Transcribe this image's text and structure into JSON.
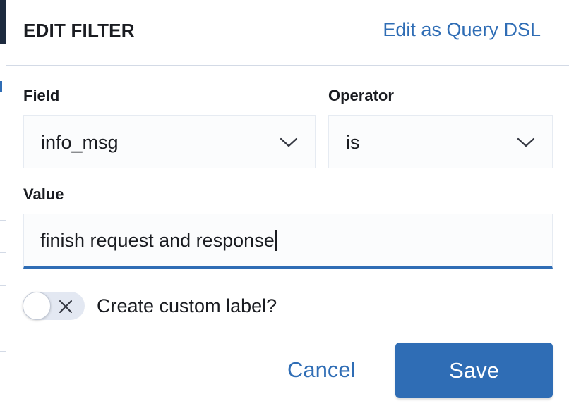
{
  "header": {
    "title": "EDIT FILTER",
    "query_link": "Edit as Query DSL"
  },
  "field": {
    "label": "Field",
    "selected": "info_msg",
    "icon": "chevron-down-icon"
  },
  "operator": {
    "label": "Operator",
    "selected": "is",
    "icon": "chevron-down-icon"
  },
  "value": {
    "label": "Value",
    "current": "finish request and response"
  },
  "custom_label": {
    "toggle_on": false,
    "toggle_icon": "close-icon",
    "label": "Create custom label?"
  },
  "actions": {
    "cancel_label": "Cancel",
    "save_label": "Save"
  },
  "colors": {
    "accent": "#2f6db5",
    "text": "#1a1c21",
    "border": "#d3dae6",
    "field_bg": "#fbfcfd"
  }
}
